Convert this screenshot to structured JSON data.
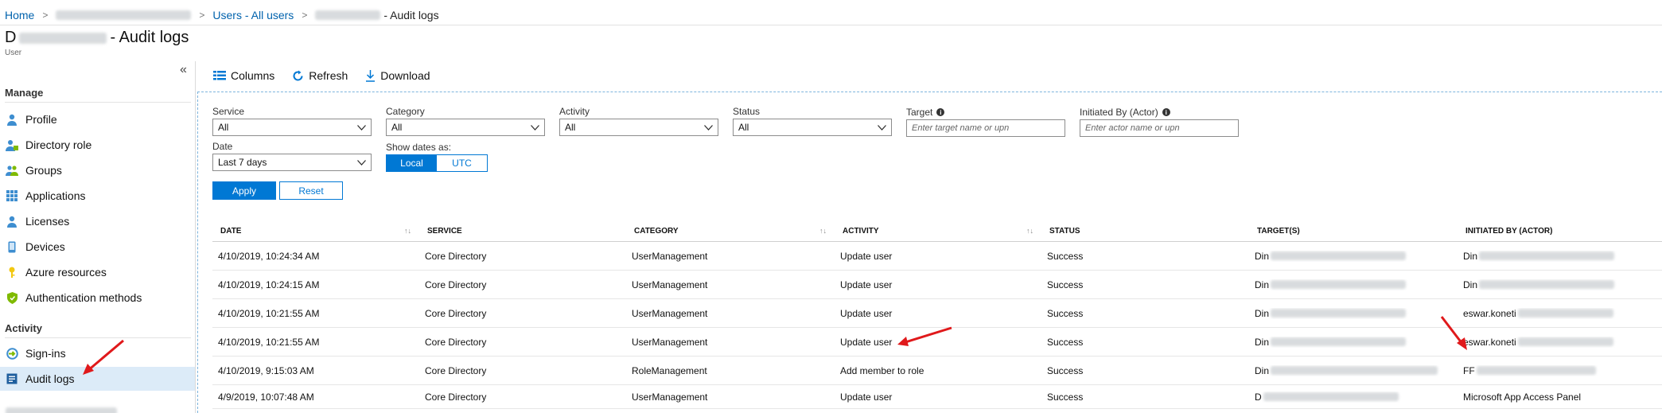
{
  "breadcrumb": {
    "home": "Home",
    "users": "Users - All users",
    "current_suffix": "- Audit logs"
  },
  "header": {
    "title_prefix": "D",
    "title_suffix": "- Audit logs",
    "subtitle": "User"
  },
  "sidebar": {
    "collapse": "«",
    "manage_label": "Manage",
    "activity_label": "Activity",
    "manage_items": [
      {
        "label": "Profile",
        "icon": "person-icon"
      },
      {
        "label": "Directory role",
        "icon": "directory-role-icon"
      },
      {
        "label": "Groups",
        "icon": "groups-icon"
      },
      {
        "label": "Applications",
        "icon": "applications-grid-icon"
      },
      {
        "label": "Licenses",
        "icon": "license-icon"
      },
      {
        "label": "Devices",
        "icon": "device-icon"
      },
      {
        "label": "Azure resources",
        "icon": "key-icon"
      },
      {
        "label": "Authentication methods",
        "icon": "shield-icon"
      }
    ],
    "activity_items": [
      {
        "label": "Sign-ins",
        "icon": "sign-in-icon"
      },
      {
        "label": "Audit logs",
        "icon": "audit-log-icon",
        "active": true
      }
    ]
  },
  "toolbar": {
    "columns": "Columns",
    "refresh": "Refresh",
    "download": "Download"
  },
  "filters": {
    "service": {
      "label": "Service",
      "value": "All"
    },
    "category": {
      "label": "Category",
      "value": "All"
    },
    "activity": {
      "label": "Activity",
      "value": "All"
    },
    "status": {
      "label": "Status",
      "value": "All"
    },
    "target": {
      "label": "Target",
      "placeholder": "Enter target name or upn"
    },
    "initiated_by": {
      "label": "Initiated By (Actor)",
      "placeholder": "Enter actor name or upn"
    },
    "date": {
      "label": "Date",
      "value": "Last 7 days"
    },
    "show_dates": {
      "label": "Show dates as:",
      "options": [
        "Local",
        "UTC"
      ],
      "selected": "Local"
    },
    "apply": "Apply",
    "reset": "Reset"
  },
  "table": {
    "columns": [
      "Date",
      "Service",
      "Category",
      "Activity",
      "Status",
      "Target(s)",
      "Initiated by (actor)"
    ],
    "rows": [
      {
        "date": "4/10/2019, 10:24:34 AM",
        "service": "Core Directory",
        "category": "UserManagement",
        "activity": "Update user",
        "status": "Success",
        "target": "Din",
        "actor": "Din"
      },
      {
        "date": "4/10/2019, 10:24:15 AM",
        "service": "Core Directory",
        "category": "UserManagement",
        "activity": "Update user",
        "status": "Success",
        "target": "Din",
        "actor": "Din"
      },
      {
        "date": "4/10/2019, 10:21:55 AM",
        "service": "Core Directory",
        "category": "UserManagement",
        "activity": "Update user",
        "status": "Success",
        "target": "Din",
        "actor": "eswar.koneti"
      },
      {
        "date": "4/10/2019, 10:21:55 AM",
        "service": "Core Directory",
        "category": "UserManagement",
        "activity": "Update user",
        "status": "Success",
        "target": "Din",
        "actor": "eswar.koneti"
      },
      {
        "date": "4/10/2019, 9:15:03 AM",
        "service": "Core Directory",
        "category": "RoleManagement",
        "activity": "Add member to role",
        "status": "Success",
        "target": "Din",
        "actor": "FF"
      },
      {
        "date": "4/9/2019, 10:07:48 AM",
        "service": "Core Directory",
        "category": "UserManagement",
        "activity": "Update user",
        "status": "Success",
        "target": "D",
        "actor": "Microsoft App Access Panel"
      }
    ]
  },
  "colors": {
    "accent": "#0078d4",
    "link": "#0062ad",
    "active_nav": "#dcebf8",
    "annotation_arrow": "#e0191b"
  }
}
